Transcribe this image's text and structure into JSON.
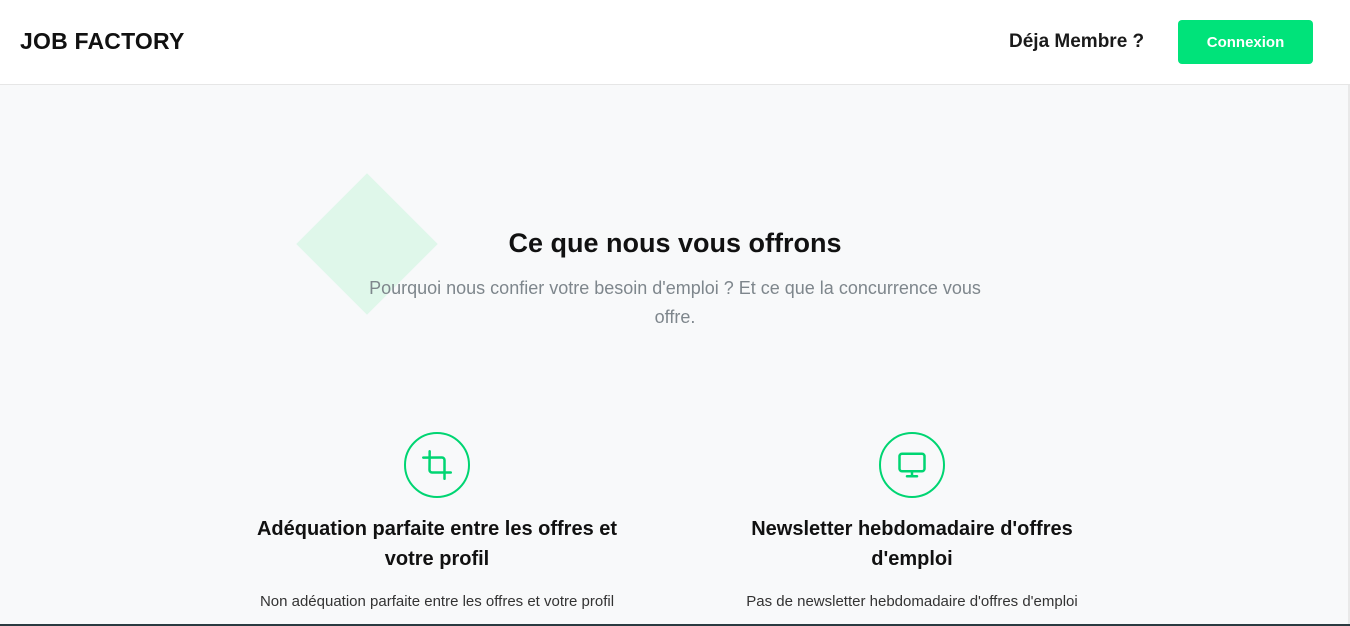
{
  "navbar": {
    "brand": "JOB FACTORY",
    "member_prompt": "Déja Membre ?",
    "login_label": "Connexion"
  },
  "section": {
    "title": "Ce que nous vous offrons",
    "subtitle": "Pourquoi nous confier votre besoin d'emploi ? Et ce que la concurrence vous offre."
  },
  "features": [
    {
      "icon": "crop-icon",
      "title": "Adéquation parfaite entre les offres et votre profil",
      "text": "Non adéquation parfaite entre les offres et votre profil"
    },
    {
      "icon": "monitor-icon",
      "title": "Newsletter hebdomadaire d'offres d'emploi",
      "text": "Pas de newsletter hebdomadaire d'offres d'emploi"
    }
  ],
  "colors": {
    "accent": "#00e37a",
    "accent_light": "#dff7ea",
    "background": "#f8f9fa",
    "muted_text": "#7e868c"
  }
}
